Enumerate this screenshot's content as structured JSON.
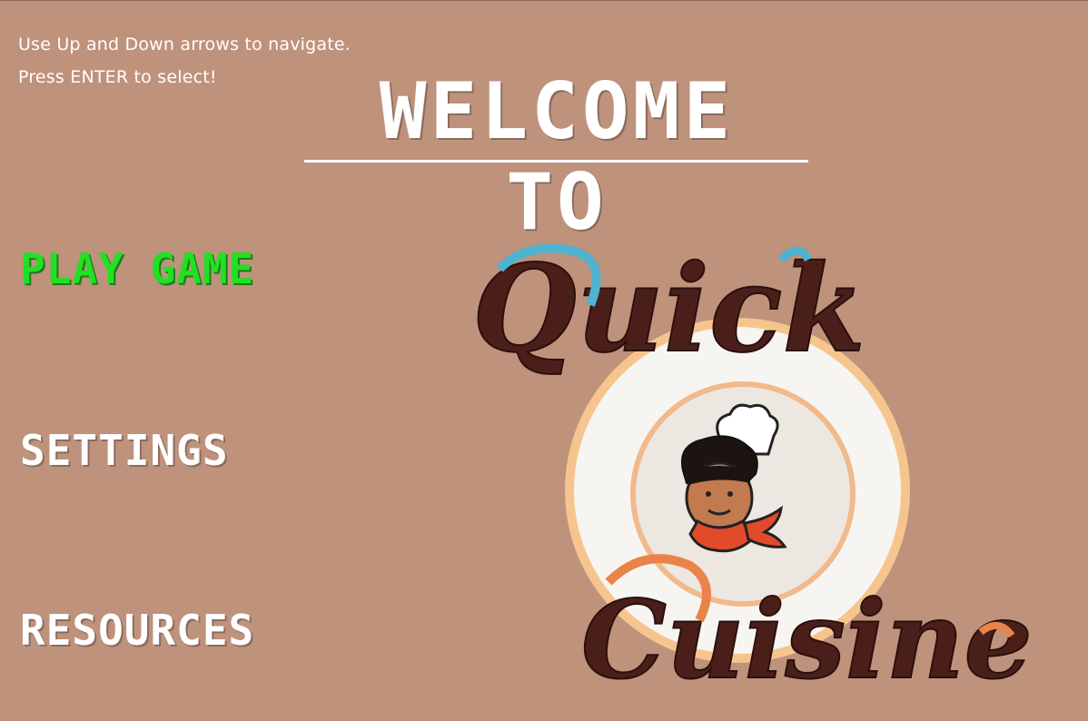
{
  "instructions": {
    "line1": "Use Up and Down arrows to navigate.",
    "line2": "Press ENTER to select!"
  },
  "header": {
    "title": "WELCOME TO"
  },
  "menu": {
    "items": [
      {
        "label": "PLAY GAME",
        "selected": true
      },
      {
        "label": "SETTINGS",
        "selected": false
      },
      {
        "label": "RESOURCES",
        "selected": false
      }
    ]
  },
  "logo": {
    "word_top": "Quick",
    "word_bottom": "Cuisine",
    "mascot_icon": "chef-icon",
    "plate_icon": "plate-icon"
  },
  "colors": {
    "background": "#bf927c",
    "selected": "#22e022",
    "text": "#ffffff",
    "accent_blue": "#4fb3cf",
    "accent_orange": "#e8844a",
    "script_brown": "#4a1f1a"
  }
}
